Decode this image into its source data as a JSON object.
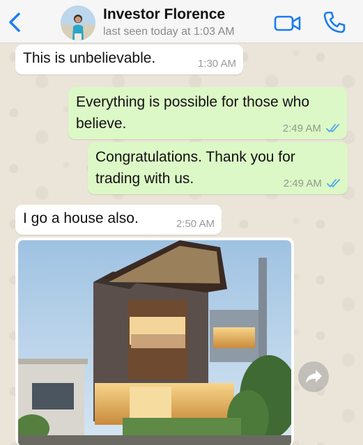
{
  "header": {
    "back_icon": "chevron-left-icon",
    "contact_name": "Investor Florence",
    "status": "last seen today at 1:03 AM",
    "video_icon": "video-camera-icon",
    "call_icon": "phone-icon",
    "accent_color": "#1a7cf2"
  },
  "messages": [
    {
      "direction": "incoming",
      "text": "This is unbelievable.",
      "time": "1:30 AM"
    },
    {
      "direction": "outgoing",
      "text": "Everything is possible for those who believe.",
      "time": "2:49 AM",
      "status_icon": "double-check-icon"
    },
    {
      "direction": "outgoing",
      "text": "Congratulations. Thank you for trading with us.",
      "time": "2:49 AM",
      "status_icon": "double-check-icon"
    },
    {
      "direction": "incoming",
      "text": "I go a house also.",
      "time": "2:50 AM"
    },
    {
      "direction": "incoming",
      "type": "image",
      "image_subject": "modern-house-photo"
    }
  ],
  "share_icon": "forward-arrow-icon",
  "colors": {
    "incoming_bubble": "#ffffff",
    "outgoing_bubble": "#dcf8c6",
    "read_ticks": "#4fa7e8"
  }
}
